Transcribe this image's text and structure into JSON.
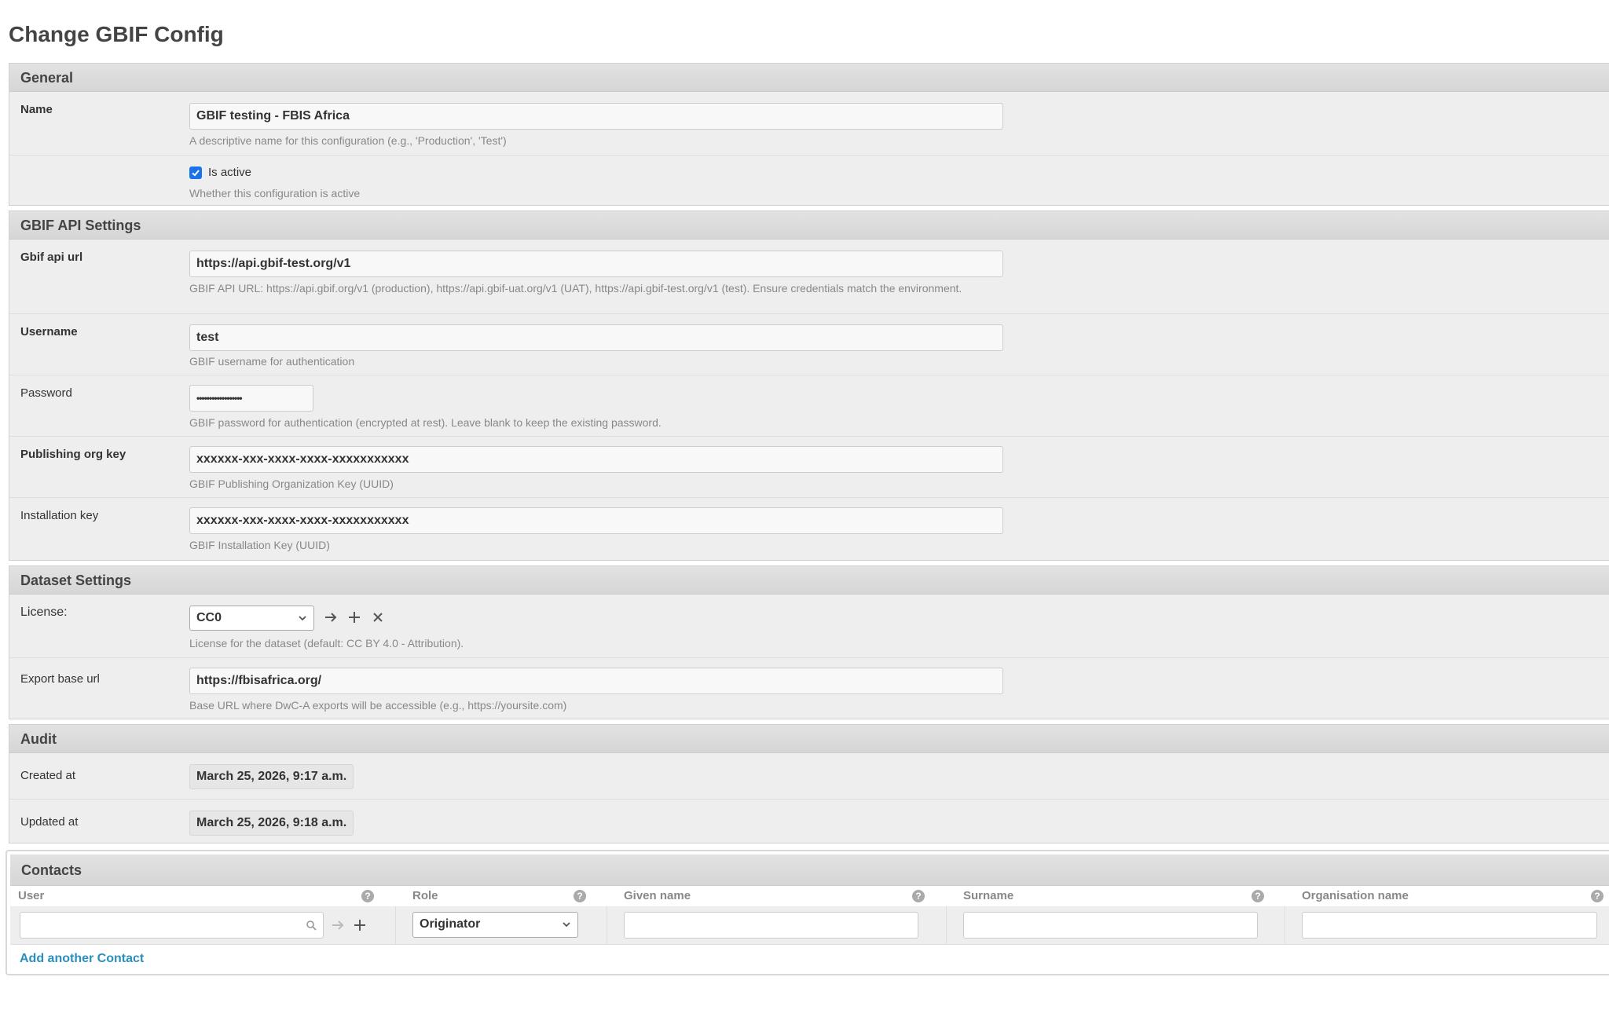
{
  "page": {
    "title": "Change GBIF Config"
  },
  "general": {
    "heading": "General",
    "name": {
      "label": "Name",
      "value": "GBIF testing - FBIS Africa",
      "help": "A descriptive name for this configuration (e.g., 'Production', 'Test')"
    },
    "is_active": {
      "label": "Is active",
      "checked": true,
      "help": "Whether this configuration is active"
    }
  },
  "api": {
    "heading": "GBIF API Settings",
    "url": {
      "label": "Gbif api url",
      "value": "https://api.gbif-test.org/v1",
      "help": "GBIF API URL: https://api.gbif.org/v1 (production), https://api.gbif-uat.org/v1 (UAT), https://api.gbif-test.org/v1 (test). Ensure credentials match the environment."
    },
    "username": {
      "label": "Username",
      "value": "test",
      "help": "GBIF username for authentication"
    },
    "password": {
      "label": "Password",
      "value": "••••••••••••••••••",
      "help": "GBIF password for authentication (encrypted at rest). Leave blank to keep the existing password."
    },
    "org_key": {
      "label": "Publishing org key",
      "value": "xxxxxx-xxx-xxxx-xxxx-xxxxxxxxxxx",
      "help": "GBIF Publishing Organization Key (UUID)"
    },
    "install_key": {
      "label": "Installation key",
      "value": "xxxxxx-xxx-xxxx-xxxx-xxxxxxxxxxx",
      "help": "GBIF Installation Key (UUID)"
    }
  },
  "dataset": {
    "heading": "Dataset Settings",
    "license": {
      "label": "License:",
      "value": "CC0",
      "help": "License for the dataset (default: CC BY 4.0 - Attribution)."
    },
    "export_url": {
      "label": "Export base url",
      "value": "https://fbisafrica.org/",
      "help": "Base URL where DwC-A exports will be accessible (e.g., https://yoursite.com)"
    }
  },
  "audit": {
    "heading": "Audit",
    "created": {
      "label": "Created at",
      "value": "March 25, 2026, 9:17 a.m."
    },
    "updated": {
      "label": "Updated at",
      "value": "March 25, 2026, 9:18 a.m."
    }
  },
  "contacts": {
    "heading": "Contacts",
    "columns": {
      "user": "User",
      "role": "Role",
      "given_name": "Given name",
      "surname": "Surname",
      "organisation": "Organisation name"
    },
    "help_glyph": "?",
    "row": {
      "role": "Originator"
    },
    "add_link": "Add another Contact"
  },
  "icons": {
    "checkbox": "checkmark-icon",
    "arrow": "arrow-right-icon",
    "plus": "plus-icon",
    "close": "close-icon",
    "chevron": "chevron-down-icon",
    "search": "search-icon"
  },
  "colors": {
    "accent": "#1a73e8",
    "link": "#2a8fbd",
    "fieldset_bg": "#eeeeee",
    "header_bg": "#d9d9d9"
  }
}
